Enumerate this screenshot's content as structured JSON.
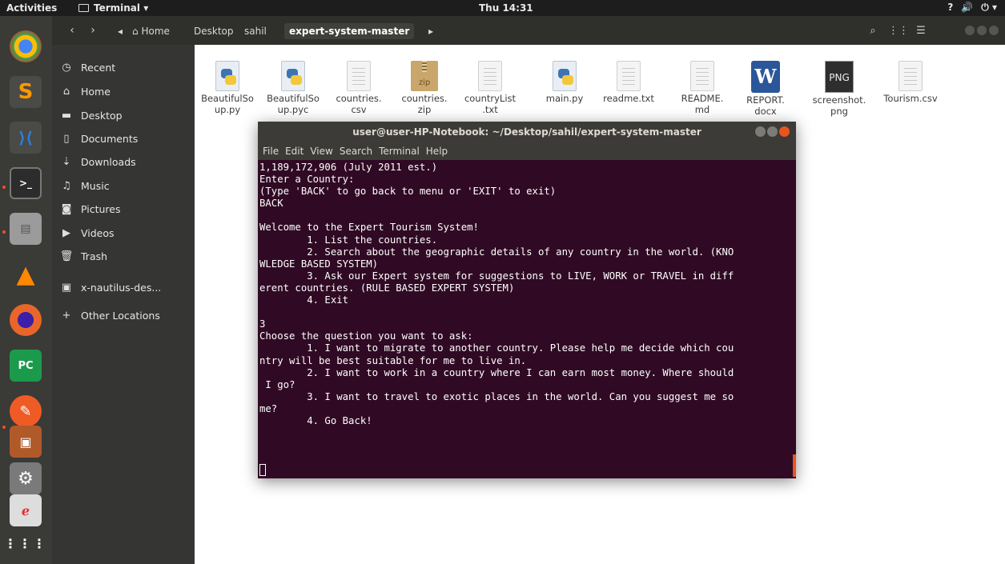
{
  "topbar": {
    "activities": "Activities",
    "app_menu": "Terminal ▾",
    "clock": "Thu 14:31",
    "status_help": "?",
    "status_volume": "🔊",
    "status_power": "⏻ ▾"
  },
  "dock": {
    "items": [
      {
        "name": "chrome",
        "color": "#d93025"
      },
      {
        "name": "sublime",
        "color": "#ff9800"
      },
      {
        "name": "vscode",
        "color": "#2b7fd4"
      },
      {
        "name": "terminal",
        "color": "#2c2c2c"
      },
      {
        "name": "files",
        "color": "#9b9b9b"
      },
      {
        "name": "vlc",
        "color": "#ff8800"
      },
      {
        "name": "firefox",
        "color": "#e8662a"
      },
      {
        "name": "pycharm",
        "color": "#1c9a4c"
      },
      {
        "name": "postman",
        "color": "#ef5b25"
      },
      {
        "name": "archive-manager",
        "color": "#b05a2a"
      },
      {
        "name": "settings",
        "color": "#7a7a7a"
      },
      {
        "name": "typora",
        "color": "#e03030"
      },
      {
        "name": "app-grid",
        "color": "#3a3a37"
      }
    ]
  },
  "header": {
    "back": "‹",
    "forward": "›",
    "crumb_toggle": "◂",
    "home_icon": "⌂",
    "breadcrumbs": [
      "Home",
      "Desktop",
      "sahil",
      "expert-system-master"
    ],
    "crumb_next": "▸",
    "search_icon": "⌕",
    "view_icon": "⋮⋮",
    "menu_icon": "☰"
  },
  "sidebar": {
    "items": [
      {
        "icon": "◷",
        "label": "Recent"
      },
      {
        "icon": "⌂",
        "label": "Home"
      },
      {
        "icon": "▬",
        "label": "Desktop"
      },
      {
        "icon": "▯",
        "label": "Documents"
      },
      {
        "icon": "⇣",
        "label": "Downloads"
      },
      {
        "icon": "♫",
        "label": "Music"
      },
      {
        "icon": "◙",
        "label": "Pictures"
      },
      {
        "icon": "▶",
        "label": "Videos"
      },
      {
        "icon": "🗑",
        "label": "Trash"
      },
      {
        "icon": "▣",
        "label": "x-nautilus-des..."
      },
      {
        "icon": "+",
        "label": "Other Locations"
      }
    ]
  },
  "files": [
    {
      "name_line1": "BeautifulSo",
      "name_line2": "up.py",
      "kind": "py"
    },
    {
      "name_line1": "BeautifulSo",
      "name_line2": "up.pyc",
      "kind": "py"
    },
    {
      "name_line1": "countries.",
      "name_line2": "csv",
      "kind": "doc"
    },
    {
      "name_line1": "countries.",
      "name_line2": "zip",
      "kind": "zip"
    },
    {
      "name_line1": "countryList",
      "name_line2": ".txt",
      "kind": "doc"
    },
    {
      "name_line1": "main.py",
      "name_line2": "",
      "kind": "py"
    },
    {
      "name_line1": "readme.txt",
      "name_line2": "",
      "kind": "doc"
    },
    {
      "name_line1": "README.",
      "name_line2": "md",
      "kind": "doc"
    },
    {
      "name_line1": "REPORT.",
      "name_line2": "docx",
      "kind": "word"
    },
    {
      "name_line1": "screenshot.",
      "name_line2": "png",
      "kind": "png"
    },
    {
      "name_line1": "Tourism.csv",
      "name_line2": "",
      "kind": "doc"
    }
  ],
  "file_icon_labels": {
    "zip": "zip",
    "word": "W",
    "png": "PNG"
  },
  "terminal": {
    "title": "user@user-HP-Notebook: ~/Desktop/sahil/expert-system-master",
    "menu": [
      "File",
      "Edit",
      "View",
      "Search",
      "Terminal",
      "Help"
    ],
    "lines": [
      "1,189,172,906 (July 2011 est.)",
      "Enter a Country:",
      "(Type 'BACK' to go back to menu or 'EXIT' to exit)",
      "BACK",
      "",
      "Welcome to the Expert Tourism System!",
      "        1. List the countries.",
      "        2. Search about the geographic details of any country in the world. (KNO",
      "WLEDGE BASED SYSTEM)",
      "        3. Ask our Expert system for suggestions to LIVE, WORK or TRAVEL in diff",
      "erent countries. (RULE BASED EXPERT SYSTEM)",
      "        4. Exit",
      "",
      "3",
      "Choose the question you want to ask:",
      "        1. I want to migrate to another country. Please help me decide which cou",
      "ntry will be best suitable for me to live in.",
      "        2. I want to work in a country where I can earn most money. Where should",
      " I go?",
      "        3. I want to travel to exotic places in the world. Can you suggest me so",
      "me?",
      "        4. Go Back!"
    ]
  },
  "colors": {
    "terminal_bg": "#300a24",
    "accent": "#e95420"
  }
}
